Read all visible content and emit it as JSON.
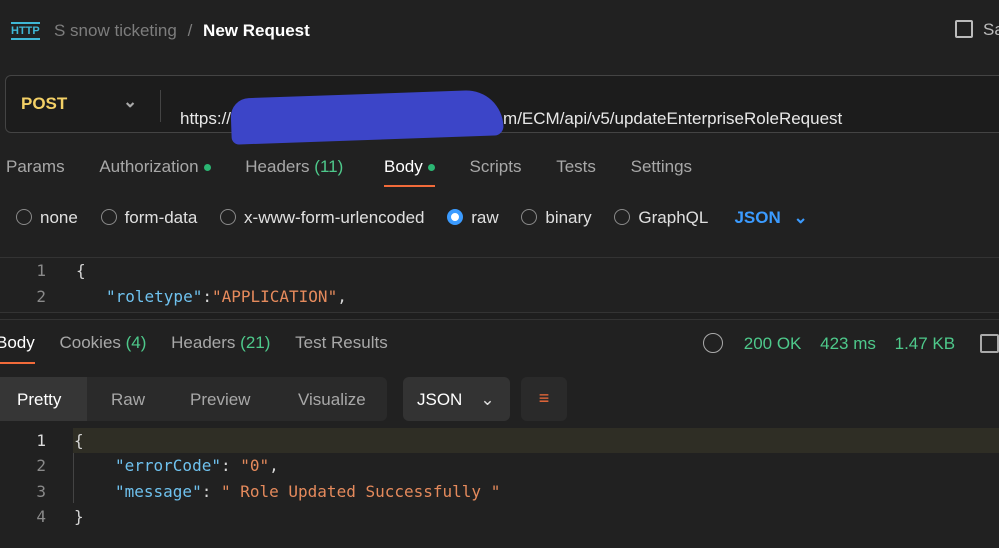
{
  "header": {
    "collection": "S snow ticketing",
    "separator": "/",
    "title": "New Request",
    "save_label": "Sa",
    "http_icon": "HTTP"
  },
  "request": {
    "method": "POST",
    "url_prefix": "https://",
    "url_suffix": "m/ECM/api/v5/updateEnterpriseRoleRequest"
  },
  "req_tabs": [
    {
      "label": "Params"
    },
    {
      "label": "Authorization"
    },
    {
      "label": "Headers",
      "count": "(11)"
    },
    {
      "label": "Body"
    },
    {
      "label": "Scripts"
    },
    {
      "label": "Tests"
    },
    {
      "label": "Settings"
    }
  ],
  "body_types": [
    "none",
    "form-data",
    "x-www-form-urlencoded",
    "raw",
    "binary",
    "GraphQL"
  ],
  "body_format": "JSON",
  "req_body": {
    "l1": "1",
    "l2": "2",
    "brace": "{",
    "key": "\"roletype\"",
    "colon": ":",
    "val": "\"APPLICATION\"",
    "comma": ","
  },
  "resp_tabs": [
    {
      "label": "Body"
    },
    {
      "label": "Cookies",
      "count": "(4)"
    },
    {
      "label": "Headers",
      "count": "(21)"
    },
    {
      "label": "Test Results"
    }
  ],
  "status": {
    "code": "200 OK",
    "time": "423 ms",
    "size": "1.47 KB",
    "color": "#4ec98b"
  },
  "view_modes": [
    "Pretty",
    "Raw",
    "Preview",
    "Visualize"
  ],
  "resp_format": "JSON",
  "resp_body": {
    "lines": [
      "1",
      "2",
      "3",
      "4"
    ],
    "open": "{",
    "k1": "\"errorCode\"",
    "v1": "\"0\"",
    "k2": "\"message\"",
    "v2": "\" Role Updated Successfully \"",
    "close": "}"
  }
}
